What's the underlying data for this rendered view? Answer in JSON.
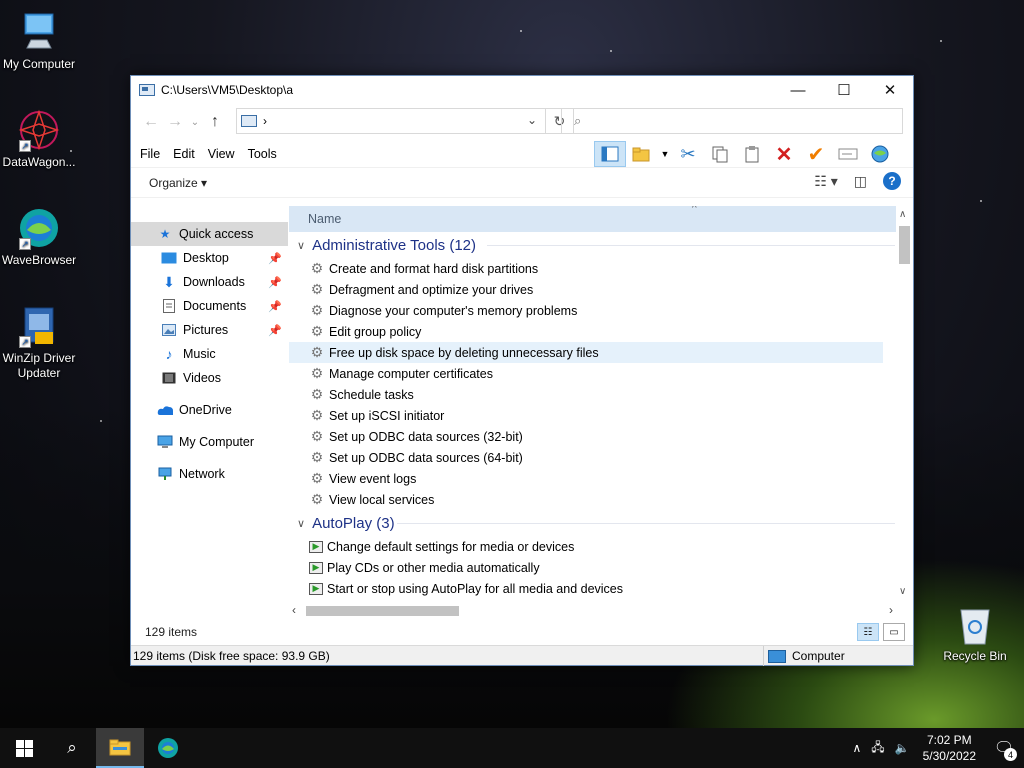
{
  "desktop": {
    "icons": [
      {
        "label": "My Computer"
      },
      {
        "label": "DataWagon..."
      },
      {
        "label": "WaveBrowser"
      },
      {
        "label": "WinZip Driver Updater"
      },
      {
        "label": "Recycle Bin"
      }
    ]
  },
  "window": {
    "title": "C:\\Users\\VM5\\Desktop\\a",
    "controls": {
      "minimize": "—",
      "maximize": "☐",
      "close": "✕"
    },
    "address": {
      "path": "›"
    },
    "search": {
      "placeholder": ""
    },
    "menu": [
      "File",
      "Edit",
      "View",
      "Tools"
    ],
    "organize_label": "Organize ▾",
    "navigation": {
      "quick_access": "Quick access",
      "items": [
        {
          "label": "Desktop",
          "pinned": true
        },
        {
          "label": "Downloads",
          "pinned": true
        },
        {
          "label": "Documents",
          "pinned": true
        },
        {
          "label": "Pictures",
          "pinned": true
        },
        {
          "label": "Music",
          "pinned": false
        },
        {
          "label": "Videos",
          "pinned": false
        }
      ],
      "onedrive": "OneDrive",
      "my_computer": "My Computer",
      "network": "Network"
    },
    "column_header": "Name",
    "groups": [
      {
        "title": "Administrative Tools (12)",
        "items": [
          "Create and format hard disk partitions",
          "Defragment and optimize your drives",
          "Diagnose your computer's memory problems",
          "Edit group policy",
          "Free up disk space by deleting unnecessary files",
          "Manage computer certificates",
          "Schedule tasks",
          "Set up iSCSI initiator",
          "Set up ODBC data sources (32-bit)",
          "Set up ODBC data sources (64-bit)",
          "View event logs",
          "View local services"
        ]
      },
      {
        "title": "AutoPlay (3)",
        "items": [
          "Change default settings for media or devices",
          "Play CDs or other media automatically",
          "Start or stop using AutoPlay for all media and devices"
        ]
      }
    ],
    "item_count": "129 items",
    "status": {
      "left": "129 items (Disk free space: 93.9 GB)",
      "right": "Computer"
    }
  },
  "taskbar": {
    "time": "7:02 PM",
    "date": "5/30/2022",
    "notification_count": "4"
  }
}
